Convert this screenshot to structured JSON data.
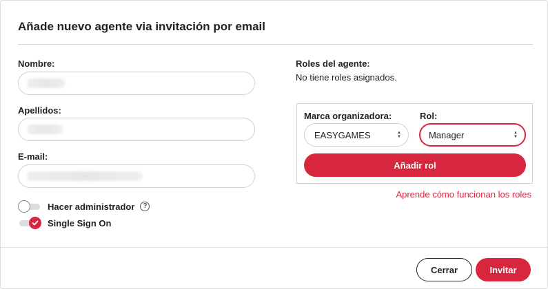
{
  "modal": {
    "title": "Añade nuevo agente via invitación por email"
  },
  "form": {
    "name": {
      "label": "Nombre:",
      "value": ""
    },
    "surname": {
      "label": "Apellidos:",
      "value": ""
    },
    "email": {
      "label": "E-mail:",
      "value": ""
    },
    "admin_toggle": {
      "label": "Hacer administrador",
      "checked": false,
      "help_icon": "question-circle-icon"
    },
    "sso_toggle": {
      "label": "Single Sign On",
      "checked": true,
      "check_icon": "check-icon"
    }
  },
  "roles": {
    "title": "Roles del agente:",
    "empty_text": "No tiene roles asignados.",
    "brand_label": "Marca organizadora:",
    "brand_value": "EASYGAMES",
    "role_label": "Rol:",
    "role_value": "Manager",
    "add_button": "Añadir rol",
    "help_link": "Aprende cómo funcionan los roles"
  },
  "footer": {
    "cancel_label": "Cerrar",
    "submit_label": "Invitar"
  },
  "colors": {
    "accent": "#d7263d",
    "border": "#cfcfcf",
    "text": "#222222"
  }
}
